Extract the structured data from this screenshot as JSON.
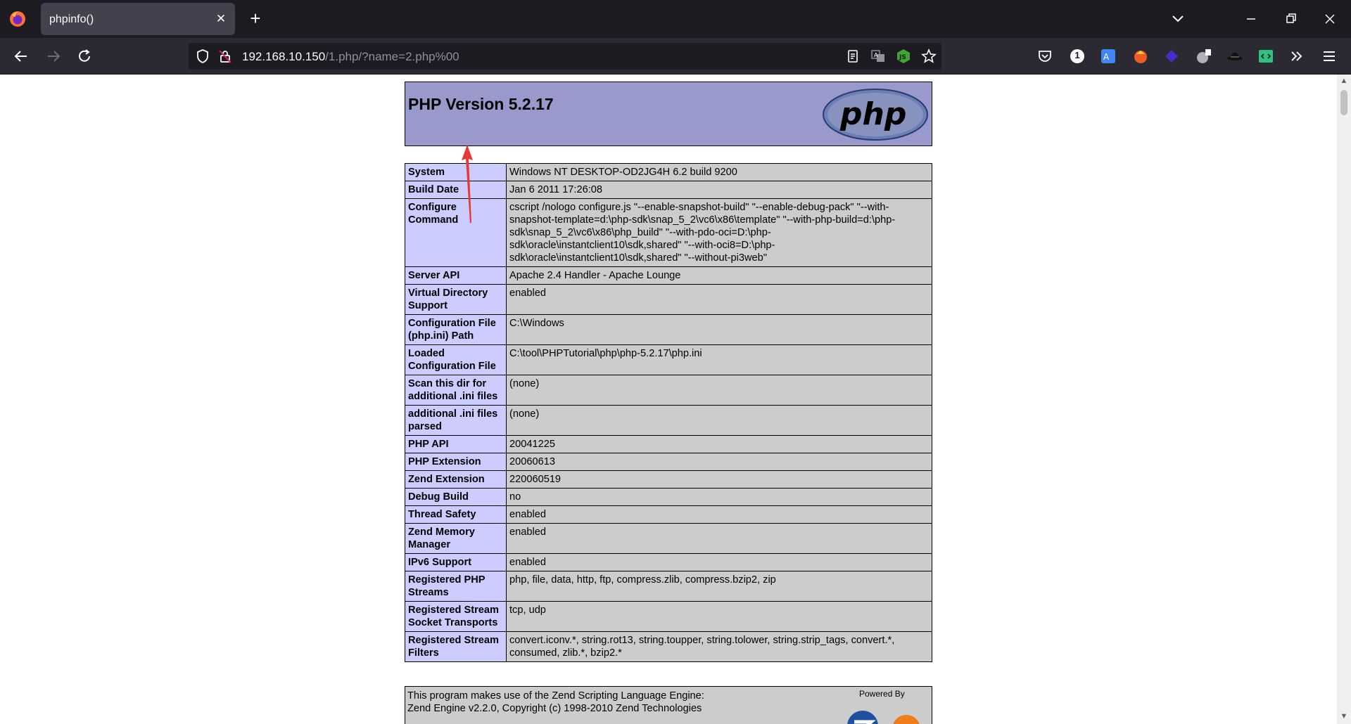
{
  "browser": {
    "tab": {
      "title": "phpinfo()"
    },
    "url": {
      "host": "192.168.10.150",
      "path": "/1.php/?name=2.php%00"
    },
    "toolbar_badge": "1"
  },
  "page": {
    "header_title": "PHP Version 5.2.17",
    "rows": [
      {
        "label": "System",
        "value": "Windows NT DESKTOP-OD2JG4H 6.2 build 9200"
      },
      {
        "label": "Build Date",
        "value": "Jan 6 2011 17:26:08"
      },
      {
        "label": "Configure Command",
        "value": "cscript /nologo configure.js \"--enable-snapshot-build\" \"--enable-debug-pack\" \"--with-snapshot-template=d:\\php-sdk\\snap_5_2\\vc6\\x86\\template\" \"--with-php-build=d:\\php-sdk\\snap_5_2\\vc6\\x86\\php_build\" \"--with-pdo-oci=D:\\php-sdk\\oracle\\instantclient10\\sdk,shared\" \"--with-oci8=D:\\php-sdk\\oracle\\instantclient10\\sdk,shared\" \"--without-pi3web\""
      },
      {
        "label": "Server API",
        "value": "Apache 2.4 Handler - Apache Lounge"
      },
      {
        "label": "Virtual Directory Support",
        "value": "enabled"
      },
      {
        "label": "Configuration File (php.ini) Path",
        "value": "C:\\Windows"
      },
      {
        "label": "Loaded Configuration File",
        "value": "C:\\tool\\PHPTutorial\\php\\php-5.2.17\\php.ini"
      },
      {
        "label": "Scan this dir for additional .ini files",
        "value": "(none)"
      },
      {
        "label": "additional .ini files parsed",
        "value": "(none)"
      },
      {
        "label": "PHP API",
        "value": "20041225"
      },
      {
        "label": "PHP Extension",
        "value": "20060613"
      },
      {
        "label": "Zend Extension",
        "value": "220060519"
      },
      {
        "label": "Debug Build",
        "value": "no"
      },
      {
        "label": "Thread Safety",
        "value": "enabled"
      },
      {
        "label": "Zend Memory Manager",
        "value": "enabled"
      },
      {
        "label": "IPv6 Support",
        "value": "enabled"
      },
      {
        "label": "Registered PHP Streams",
        "value": "php, file, data, http, ftp, compress.zlib, compress.bzip2, zip"
      },
      {
        "label": "Registered Stream Socket Transports",
        "value": "tcp, udp"
      },
      {
        "label": "Registered Stream Filters",
        "value": "convert.iconv.*, string.rot13, string.toupper, string.tolower, string.strip_tags, convert.*, consumed, zlib.*, bzip2.*"
      }
    ],
    "footer": {
      "line1": "This program makes use of the Zend Scripting Language Engine:",
      "line2": "Zend Engine v2.2.0, Copyright (c) 1998-2010 Zend Technologies",
      "powered_by": "Powered By"
    },
    "logo_text": "php"
  },
  "colors": {
    "header_bg": "#9999cc",
    "label_bg": "#ccccff",
    "value_bg": "#cccccc",
    "annotation_arrow": "#e53935"
  }
}
